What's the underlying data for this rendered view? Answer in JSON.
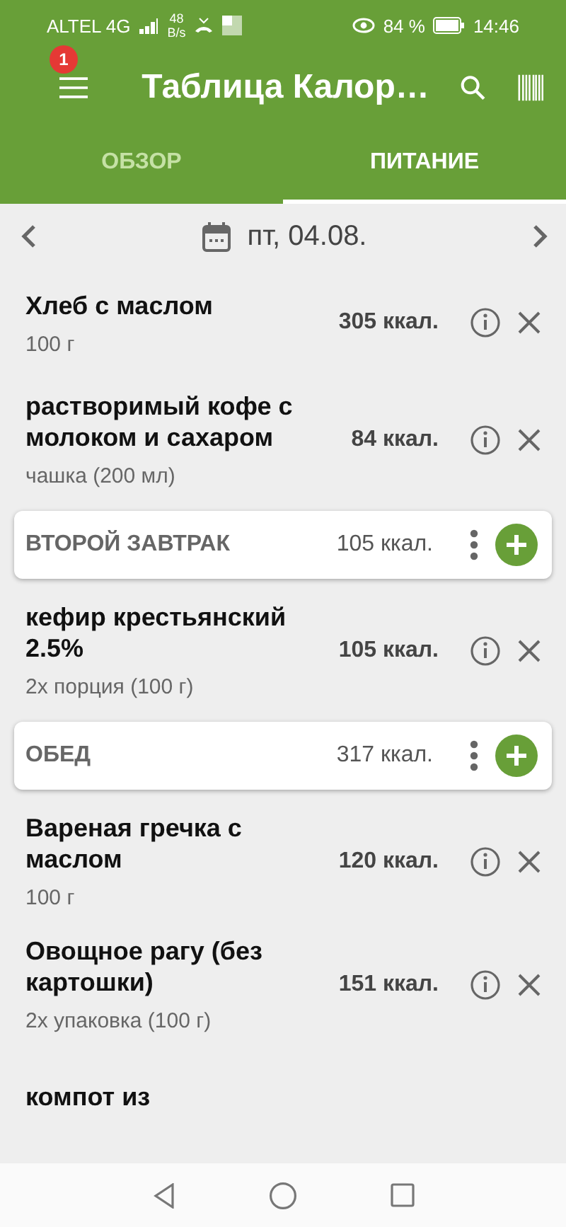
{
  "status_bar": {
    "carrier": "ALTEL 4G",
    "speed_value": "48",
    "speed_unit": "B/s",
    "battery": "84 %",
    "time": "14:46"
  },
  "app_bar": {
    "title": "Таблица Калор…",
    "badge": "1"
  },
  "tabs": [
    {
      "label": "ОБЗОР",
      "selected": false
    },
    {
      "label": "ПИТАНИЕ",
      "selected": true
    }
  ],
  "date": {
    "label": "пт, 04.08."
  },
  "entries": [
    {
      "kind": "food",
      "name": "Хлеб с маслом",
      "portion": "100 г",
      "calories": "305 ккал."
    },
    {
      "kind": "food",
      "name": "растворимый кофе с молоком и сахаром",
      "portion": "чашка (200 мл)",
      "calories": "84 ккал."
    },
    {
      "kind": "meal",
      "name": "ВТОРОЙ ЗАВТРАК",
      "calories": "105 ккал."
    },
    {
      "kind": "food",
      "name": "кефир крестьянский 2.5%",
      "portion": "2x порция (100 г)",
      "calories": "105 ккал."
    },
    {
      "kind": "meal",
      "name": "ОБЕД",
      "calories": "317 ккал."
    },
    {
      "kind": "food",
      "name": "Вареная гречка с маслом",
      "portion": "100 г",
      "calories": "120 ккал."
    },
    {
      "kind": "food",
      "name": "Овощное рагу (без картошки)",
      "portion": "2x упаковка (100 г)",
      "calories": "151 ккал."
    },
    {
      "kind": "food",
      "name": "компот из"
    }
  ]
}
